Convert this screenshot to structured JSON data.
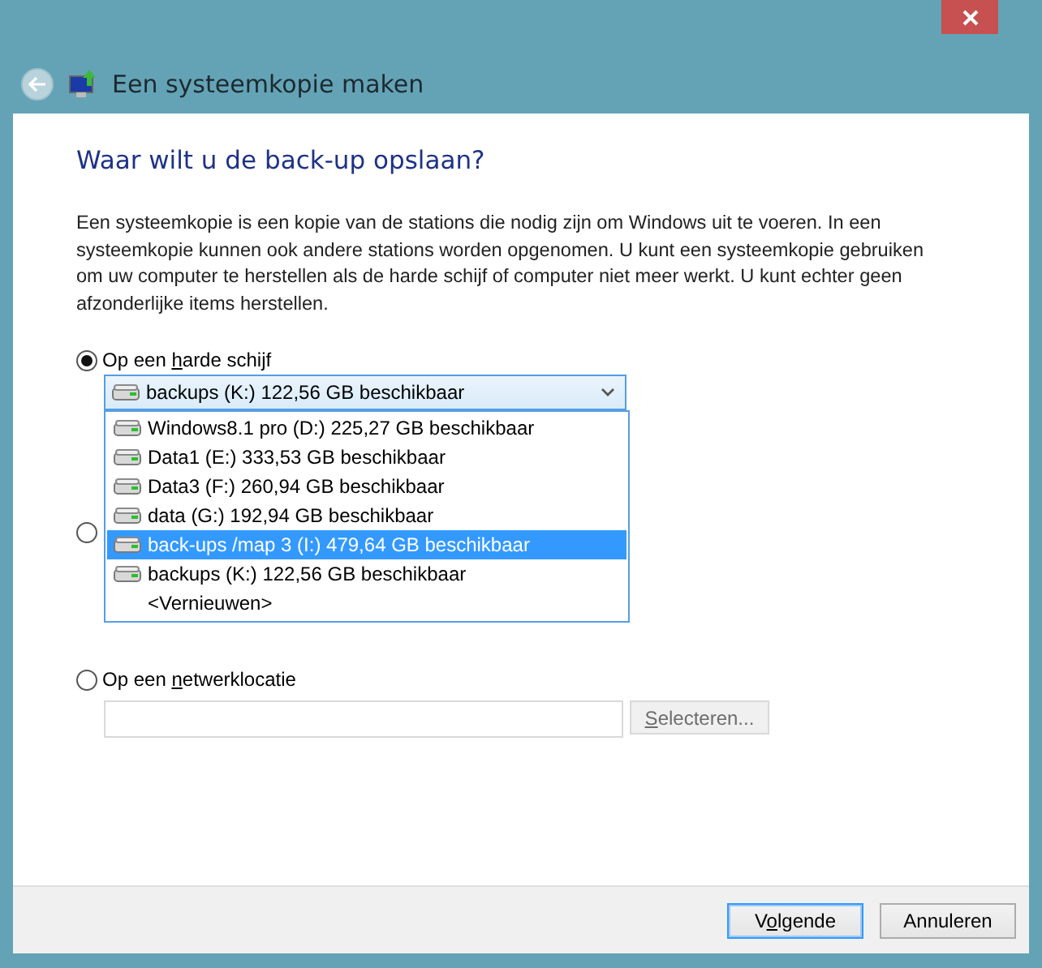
{
  "window": {
    "title": "Een systeemkopie maken"
  },
  "heading": "Waar wilt u de back-up opslaan?",
  "description": "Een systeemkopie is een kopie van de stations die nodig zijn om Windows uit te voeren. In een systeemkopie kunnen ook andere stations worden opgenomen. U kunt een systeemkopie gebruiken om uw computer te herstellen als de harde schijf of computer niet meer werkt. U kunt echter geen afzonderlijke items herstellen.",
  "options": [
    {
      "kind": "disk",
      "label_parts": {
        "pre": "Op een ",
        "key": "h",
        "post": "arde schijf"
      },
      "selected": true,
      "combo": {
        "value": "backups (K:)  122,56 GB beschikbaar",
        "expanded": true,
        "items": [
          {
            "label": "Windows8.1 pro (D:)  225,27 GB beschikbaar",
            "icon": true,
            "highlighted": false
          },
          {
            "label": "Data1 (E:)  333,53 GB beschikbaar",
            "icon": true,
            "highlighted": false
          },
          {
            "label": "Data3 (F:)  260,94 GB beschikbaar",
            "icon": true,
            "highlighted": false
          },
          {
            "label": "data (G:)  192,94 GB beschikbaar",
            "icon": true,
            "highlighted": false
          },
          {
            "label": "back-ups /map 3 (I:)  479,64 GB beschikbaar",
            "icon": true,
            "highlighted": true
          },
          {
            "label": "backups (K:)  122,56 GB beschikbaar",
            "icon": true,
            "highlighted": false
          },
          {
            "label": "<Vernieuwen>",
            "icon": false,
            "highlighted": false
          }
        ]
      }
    },
    {
      "kind": "hidden",
      "selected": false
    },
    {
      "kind": "network",
      "label_parts": {
        "pre": "Op een ",
        "key": "n",
        "post": "etwerklocatie"
      },
      "selected": false,
      "button": {
        "parts": {
          "key": "S",
          "post": "electeren..."
        },
        "disabled": true
      }
    }
  ],
  "buttons": [
    {
      "parts": {
        "pre": "V",
        "key": "o",
        "post": "lgende"
      },
      "default": true
    },
    {
      "parts": {
        "pre": "Annuleren"
      },
      "default": false
    }
  ]
}
